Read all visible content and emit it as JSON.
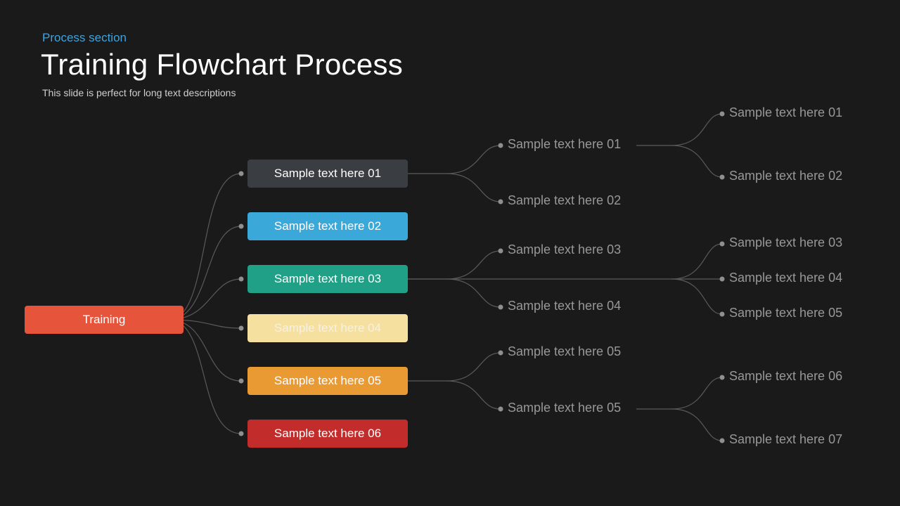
{
  "header": {
    "section_label": "Process section",
    "title": "Training Flowchart Process",
    "subtitle": "This slide is perfect for long text descriptions"
  },
  "root": {
    "label": "Training"
  },
  "level1": [
    {
      "label": "Sample text here 01",
      "color": "dark"
    },
    {
      "label": "Sample text here 02",
      "color": "blue"
    },
    {
      "label": "Sample text here 03",
      "color": "teal"
    },
    {
      "label": "Sample text here 04",
      "color": "yellow"
    },
    {
      "label": "Sample text here 05",
      "color": "orange"
    },
    {
      "label": "Sample text here 06",
      "color": "red"
    }
  ],
  "level2": {
    "branch_a": [
      {
        "label": "Sample text here 01"
      },
      {
        "label": "Sample text here 02"
      }
    ],
    "branch_b": [
      {
        "label": "Sample text here 03"
      },
      {
        "label": "Sample text here 04"
      }
    ],
    "branch_c": [
      {
        "label": "Sample text here 05"
      },
      {
        "label": "Sample text here 05"
      }
    ]
  },
  "level3": {
    "group_a": [
      {
        "label": "Sample text here 01"
      },
      {
        "label": "Sample text here 02"
      }
    ],
    "group_b": [
      {
        "label": "Sample text here 03"
      },
      {
        "label": "Sample text here 04"
      },
      {
        "label": "Sample text here 05"
      }
    ],
    "group_c": [
      {
        "label": "Sample text here 06"
      },
      {
        "label": "Sample text here 07"
      }
    ]
  },
  "colors": {
    "root": "#e6543b",
    "dark": "#3a3d41",
    "blue": "#3aa9d9",
    "teal": "#1fa087",
    "yellow": "#f5e09f",
    "orange": "#ea9a33",
    "red": "#c22d2b",
    "accent_text": "#3fa3dd",
    "connector": "#5a5a5a",
    "dot": "#8f8f8f",
    "text_dim": "#989898",
    "bg": "#1a1a1a"
  }
}
